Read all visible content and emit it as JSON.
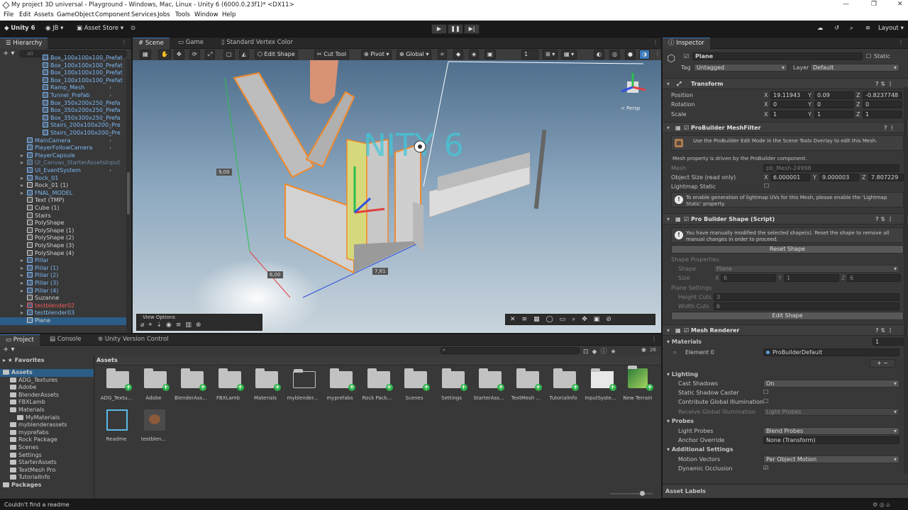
{
  "window": {
    "title": "My project 3D universal - Playground - Windows, Mac, Linux - Unity 6 (6000.0.23f1)* <DX11>"
  },
  "menu": [
    "File",
    "Edit",
    "Assets",
    "GameObject",
    "Component",
    "Services",
    "Jobs",
    "Tools",
    "Window",
    "Help"
  ],
  "toolbar": {
    "unity": "Unity 6",
    "account": "JB",
    "asset_store": "Asset Store",
    "layout": "Layout"
  },
  "hierarchy": {
    "tab": "Hierarchy",
    "search_placeholder": "All",
    "items": [
      {
        "label": "Box_100x100x100_Prefat",
        "indent": 2,
        "color": "blue"
      },
      {
        "label": "Box_100x100x100_Prefat",
        "indent": 2,
        "color": "blue"
      },
      {
        "label": "Box_100x100x100_Prefat",
        "indent": 2,
        "color": "blue"
      },
      {
        "label": "Box_100x100x100_Prefat",
        "indent": 2,
        "color": "blue"
      },
      {
        "label": "Ramp_Mesh",
        "indent": 2,
        "color": "blue"
      },
      {
        "label": "Tunnel_Prefab",
        "indent": 2,
        "color": "blue"
      },
      {
        "label": "Box_350x200x250_Prefa",
        "indent": 2,
        "color": "blue"
      },
      {
        "label": "Box_350x200x250_Prefa",
        "indent": 2,
        "color": "blue"
      },
      {
        "label": "Box_350x300x250_Prefa",
        "indent": 2,
        "color": "blue"
      },
      {
        "label": "Stairs_200x100x200_Pre",
        "indent": 2,
        "color": "blue"
      },
      {
        "label": "Stairs_200x100x200_Pre",
        "indent": 2,
        "color": "blue"
      },
      {
        "label": "MainCamera",
        "indent": 1,
        "color": "blue"
      },
      {
        "label": "PlayerFollowCamera",
        "indent": 1,
        "color": "blue"
      },
      {
        "label": "PlayerCapsule",
        "indent": 1,
        "color": "blue",
        "arrow": true
      },
      {
        "label": "UI_Canvas_StarterAssetsInput",
        "indent": 1,
        "color": "dim",
        "arrow": true
      },
      {
        "label": "UI_EventSystem",
        "indent": 1,
        "color": "blue"
      },
      {
        "label": "Rock_01",
        "indent": 1,
        "color": "blue",
        "arrow": true
      },
      {
        "label": "Rock_01 (1)",
        "indent": 1,
        "color": "white",
        "arrow": true
      },
      {
        "label": "FNAL_MODEL",
        "indent": 1,
        "color": "blue",
        "arrow": true
      },
      {
        "label": "Text (TMP)",
        "indent": 1,
        "color": "white"
      },
      {
        "label": "Cube (1)",
        "indent": 1,
        "color": "white"
      },
      {
        "label": "Stairs",
        "indent": 1,
        "color": "white"
      },
      {
        "label": "PolyShape",
        "indent": 1,
        "color": "white"
      },
      {
        "label": "PolyShape (1)",
        "indent": 1,
        "color": "white"
      },
      {
        "label": "PolyShape (2)",
        "indent": 1,
        "color": "white"
      },
      {
        "label": "PolyShape (3)",
        "indent": 1,
        "color": "white"
      },
      {
        "label": "PolyShape (4)",
        "indent": 1,
        "color": "white"
      },
      {
        "label": "Pillar",
        "indent": 1,
        "color": "blue",
        "arrow": true
      },
      {
        "label": "Pillar (1)",
        "indent": 1,
        "color": "blue",
        "arrow": true
      },
      {
        "label": "Pillar (2)",
        "indent": 1,
        "color": "blue",
        "arrow": true
      },
      {
        "label": "Pillar (3)",
        "indent": 1,
        "color": "blue",
        "arrow": true
      },
      {
        "label": "Pillar (4)",
        "indent": 1,
        "color": "blue",
        "arrow": true
      },
      {
        "label": "Suzanne",
        "indent": 1,
        "color": "white"
      },
      {
        "label": "testblender02",
        "indent": 1,
        "color": "red",
        "arrow": true
      },
      {
        "label": "testblender03",
        "indent": 1,
        "color": "blue",
        "arrow": true
      },
      {
        "label": "Plane",
        "indent": 1,
        "color": "white",
        "selected": true
      }
    ]
  },
  "scene": {
    "tabs": [
      "Scene",
      "Game",
      "Standard Vertex Color"
    ],
    "edit_shape": "Edit Shape",
    "cut_tool": "Cut Tool",
    "pivot": "Pivot",
    "global": "Global",
    "snap": "1",
    "persp": "< Persp",
    "view_options": "View Options",
    "dim_labels": [
      "9,00",
      "6,00",
      "7,81"
    ],
    "overlay_text": "NITY 6"
  },
  "inspector": {
    "tab": "Inspector",
    "object_name": "Plane",
    "static_label": "Static",
    "tag_label": "Tag",
    "tag": "Untagged",
    "layer_label": "Layer",
    "layer": "Default",
    "transform": {
      "title": "Transform",
      "rows": [
        {
          "label": "Position",
          "x": "19.11943",
          "y": "0.09",
          "z": "-0.8237748"
        },
        {
          "label": "Rotation",
          "x": "0",
          "y": "0",
          "z": "0"
        },
        {
          "label": "Scale",
          "x": "1",
          "y": "1",
          "z": "1"
        }
      ]
    },
    "meshfilter": {
      "title": "ProBuilder MeshFilter",
      "note": "Use the ProBuilder Edit Mode in the Scene Tools Overlay to edit this Mesh.",
      "driven": "Mesh property is driven by the ProBuilder component.",
      "mesh_label": "Mesh",
      "mesh": "pb_Mesh-24998",
      "size_label": "Object Size (read only)",
      "sx": "6.000001",
      "sy": "9.000003",
      "sz": "7.807229",
      "lightmap_label": "Lightmap Static",
      "lightmap_note": "To enable generation of lightmap UVs for this Mesh, please enable the 'Lightmap Static' property."
    },
    "shape": {
      "title": "Pro Builder Shape (Script)",
      "note": "You have manually modified the selected shape(s). Reset the shape to remove all manual changes in order to proceed.",
      "reset": "Reset Shape",
      "props_label": "Shape Properties",
      "shape_label": "Shape",
      "shape_value": "Plane",
      "size_label": "Size",
      "size_x": "6",
      "size_y": "1",
      "size_z": "6",
      "plane_settings": "Plane Settings",
      "height_cuts_label": "Height Cuts",
      "height_cuts": "3",
      "width_cuts_label": "Width Cuts",
      "width_cuts": "6",
      "edit_shape": "Edit Shape"
    },
    "renderer": {
      "title": "Mesh Renderer",
      "materials_label": "Materials",
      "materials_count": "1",
      "element_label": "Element 0",
      "element": "ProBuilderDefault",
      "lighting": "Lighting",
      "cast_shadows_label": "Cast Shadows",
      "cast_shadows": "On",
      "static_shadow_label": "Static Shadow Caster",
      "contribute_gi_label": "Contribute Global Illumination",
      "receive_gi_label": "Receive Global Illumination",
      "receive_gi": "Light Probes",
      "probes": "Probes",
      "light_probes_label": "Light Probes",
      "light_probes": "Blend Probes",
      "anchor_label": "Anchor Override",
      "anchor": "None (Transform)",
      "additional": "Additional Settings",
      "motion_label": "Motion Vectors",
      "motion": "Per Object Motion",
      "occlusion_label": "Dynamic Occlusion"
    },
    "asset_labels": "Asset Labels"
  },
  "project": {
    "tabs": [
      "Project",
      "Console",
      "Unity Version Control"
    ],
    "count": "26",
    "favorites": "Favorites",
    "assets_root": "Assets",
    "breadcrumb": "Assets",
    "tree": [
      {
        "label": "Assets",
        "indent": 0,
        "bold": true
      },
      {
        "label": "ADG_Textures",
        "indent": 1
      },
      {
        "label": "Adobe",
        "indent": 1
      },
      {
        "label": "BlenderAssets",
        "indent": 1
      },
      {
        "label": "FBXLamb",
        "indent": 1
      },
      {
        "label": "Materials",
        "indent": 1
      },
      {
        "label": "MyMaterials",
        "indent": 2
      },
      {
        "label": "myblenderassets",
        "indent": 1
      },
      {
        "label": "myprefabs",
        "indent": 1
      },
      {
        "label": "Rock Package",
        "indent": 1
      },
      {
        "label": "Scenes",
        "indent": 1
      },
      {
        "label": "Settings",
        "indent": 1
      },
      {
        "label": "StarterAssets",
        "indent": 1
      },
      {
        "label": "TextMesh Pro",
        "indent": 1
      },
      {
        "label": "TutorialInfo",
        "indent": 1
      },
      {
        "label": "Packages",
        "indent": 0,
        "bold": true
      }
    ],
    "assets": [
      "ADG_Textu...",
      "Adobe",
      "BlenderAss...",
      "FBXLamb",
      "Materials",
      "myblender...",
      "myprefabs",
      "Rock Pack...",
      "Scenes",
      "Settings",
      "StarterAss...",
      "TextMesh ...",
      "TutorialInfo",
      "InputSyste...",
      "New Terrain"
    ],
    "assets_row2": [
      "Readme",
      "testblen..."
    ]
  },
  "status": "Couldn't find a readme",
  "colors": {
    "accent": "#3a79bb",
    "selection": "#2c5d87",
    "prefab_blue": "#7cb6f2",
    "orange": "#f08a2c"
  }
}
